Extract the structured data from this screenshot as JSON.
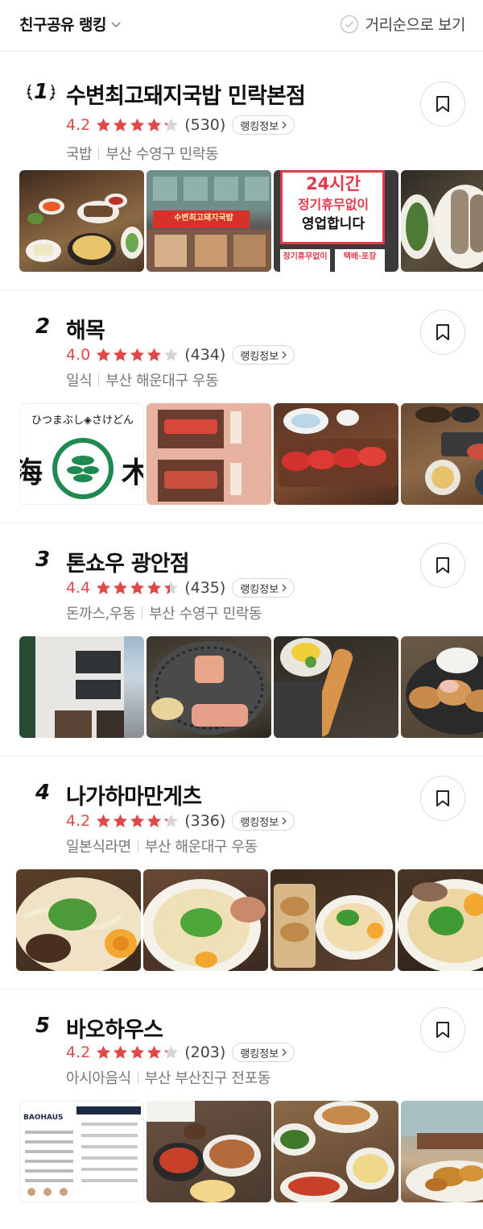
{
  "header": {
    "sort_label": "친구공유 랭킹",
    "distance_label": "거리순으로 보기"
  },
  "rank_info_label": "랭킹정보",
  "colors": {
    "accent": "#e04848",
    "star_empty": "#d6d6d6"
  },
  "places": [
    {
      "rank": "1",
      "name": "수변최고돼지국밥 민락본점",
      "score": "4.2",
      "stars": 4.2,
      "count": "(530)",
      "category": "국밥",
      "location": "부산 수영구 민락동",
      "photos": [
        "국밥 한상",
        "가게 외관",
        "24시간 안내 간판",
        "순대 접시"
      ],
      "sign_texts": {
        "storefront": "수변최고돼지국밥",
        "line1": "24시간",
        "line2": "정기휴무없이",
        "line3": "영업합니다",
        "sub1": "정기휴무없이",
        "sub2": "택배·포장"
      }
    },
    {
      "rank": "2",
      "name": "해목",
      "score": "4.0",
      "stars": 4.0,
      "count": "(434)",
      "category": "일식",
      "location": "부산 해운대구 우동",
      "photos": [
        "간판 로고",
        "참치 메뉴판",
        "참치 회",
        "정식 상차림"
      ],
      "sign_texts": {
        "logo_text": "ひつまぶし◈さけどん",
        "char_left": "海",
        "char_right": "木"
      }
    },
    {
      "rank": "3",
      "name": "톤쇼우 광안점",
      "score": "4.4",
      "stars": 4.4,
      "count": "(435)",
      "category": "돈까스,우동",
      "location": "부산 수영구 민락동",
      "photos": [
        "가게 건물",
        "돈까스 단면",
        "새우튀김",
        "돈까스 정식"
      ],
      "sign_texts": {}
    },
    {
      "rank": "4",
      "name": "나가하마만게츠",
      "score": "4.2",
      "stars": 4.2,
      "count": "(336)",
      "category": "일본식라면",
      "location": "부산 해운대구 우동",
      "photos": [
        "라멘 근접",
        "돈코츠 라멘",
        "교자와 라멘",
        "차슈 라멘"
      ],
      "sign_texts": {}
    },
    {
      "rank": "5",
      "name": "바오하우스",
      "score": "4.2",
      "stars": 4.2,
      "count": "(203)",
      "category": "아시아음식",
      "location": "부산 부산진구 전포동",
      "photos": [
        "메뉴판",
        "마파두부 상차림",
        "볶음밥과 요리",
        "탕수육"
      ],
      "sign_texts": {
        "brand": "BAOHAUS"
      }
    }
  ]
}
